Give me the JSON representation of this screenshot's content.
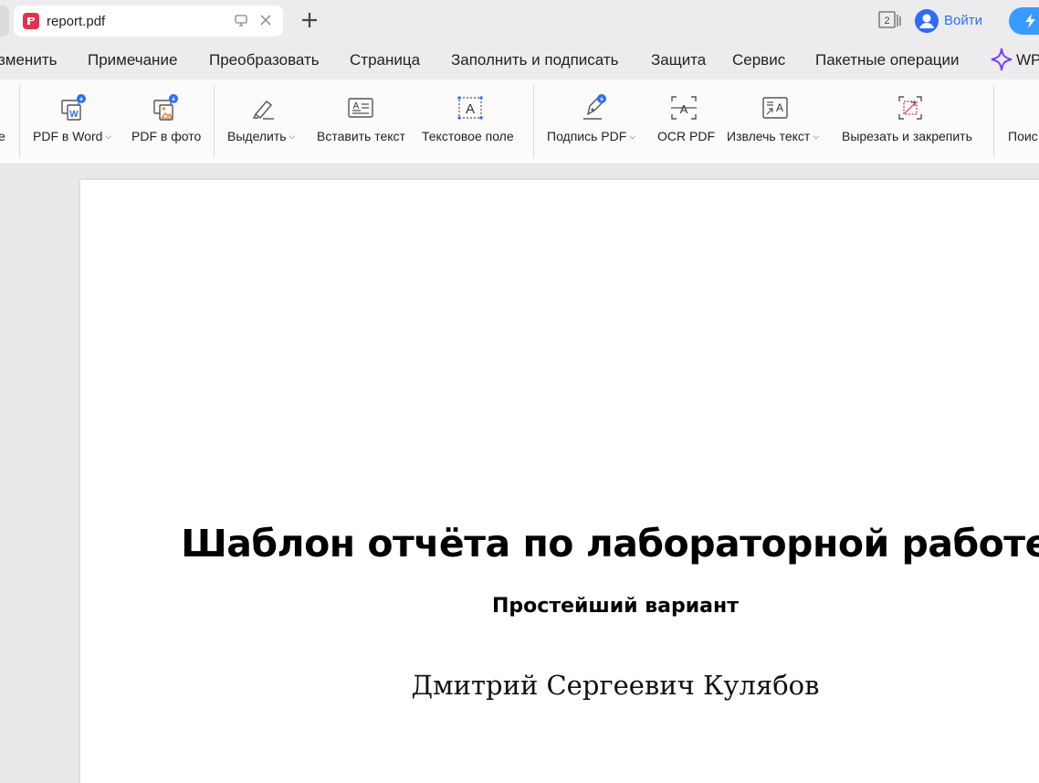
{
  "tabs": {
    "active": {
      "title": "report.pdf"
    },
    "window_count": "2",
    "login_label": "Войти"
  },
  "menu": {
    "items": [
      "зменить",
      "Примечание",
      "Преобразовать",
      "Страница",
      "Заполнить и подписать",
      "Защита",
      "Сервис",
      "Пакетные операции"
    ],
    "ai_label": "WPS"
  },
  "ribbon": {
    "tools": [
      {
        "label": "е",
        "icon": "cut-off-icon"
      },
      {
        "label": "PDF в Word",
        "icon": "pdf-to-word-icon",
        "dropdown": true
      },
      {
        "label": "PDF в фото",
        "icon": "pdf-to-image-icon"
      },
      {
        "label": "Выделить",
        "icon": "highlighter-icon",
        "dropdown": true
      },
      {
        "label": "Вставить текст",
        "icon": "insert-text-icon"
      },
      {
        "label": "Текстовое поле",
        "icon": "text-box-icon"
      },
      {
        "label": "Подпись PDF",
        "icon": "pen-signature-icon",
        "dropdown": true
      },
      {
        "label": "OCR PDF",
        "icon": "ocr-icon"
      },
      {
        "label": "Извлечь текст",
        "icon": "extract-text-icon",
        "dropdown": true
      },
      {
        "label": "Вырезать и закрепить",
        "icon": "crop-pin-icon"
      },
      {
        "label": "Поис",
        "icon": "search-cut-icon"
      }
    ]
  },
  "document": {
    "title": "Шаблон отчёта по лабораторной работе",
    "subtitle": "Простейший вариант",
    "author": "Дмитрий Сергеевич Кулябов"
  },
  "colors": {
    "accent": "#2f6bff",
    "pdf_red": "#e5324b",
    "ai_purple": "#7b3cff",
    "background": "#e9e9eb"
  }
}
